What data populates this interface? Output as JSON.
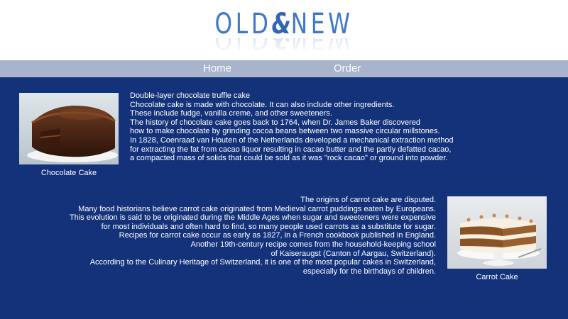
{
  "logo": {
    "old": "OLD",
    "amp": "&",
    "new": "NEW"
  },
  "nav": {
    "home": "Home",
    "order": "Order"
  },
  "chocolate": {
    "caption": "Chocolate Cake",
    "lines": [
      "Double-layer chocolate truffle cake",
      "Chocolate cake is made with chocolate. It can also include other ingredients.",
      "These include fudge, vanilla creme, and other sweeteners.",
      "The history of chocolate cake goes back to 1764, when Dr. James Baker discovered",
      "how to make chocolate by grinding cocoa beans between two massive circular millstones.",
      "In 1828, Coenraad van Houten of the Netherlands developed a mechanical extraction method",
      "for extracting the fat from cacao liquor resulting in cacao butter and the partly defatted cacao,",
      "a compacted mass of solids that could be sold as it was \"rock cacao\" or ground into powder."
    ]
  },
  "carrot": {
    "caption": "Carrot Cake",
    "lines": [
      "The origins of carrot cake are disputed.",
      "Many food historians believe carrot cake originated from Medieval carrot puddings eaten by Europeans.",
      "This evolution is said to be originated during the Middle Ages when sugar and sweeteners were expensive",
      "for most individuals and often hard to find, so many people used carrots as a substitute for sugar.",
      "Recipes for carrot cake occur as early as 1827, in a French cookbook published in England.",
      "Another 19th-century recipe comes from the household-keeping school",
      "of Kaiseraugst (Canton of Aargau, Switzerland).",
      "According to the Culinary Heritage of Switzerland, it is one of the most popular cakes in Switzerland,",
      "especially for the birthdays of children."
    ]
  },
  "colors": {
    "main_bg": "#14327a",
    "nav_bg": "#a7b4cb",
    "logo": "#3f78c8"
  }
}
